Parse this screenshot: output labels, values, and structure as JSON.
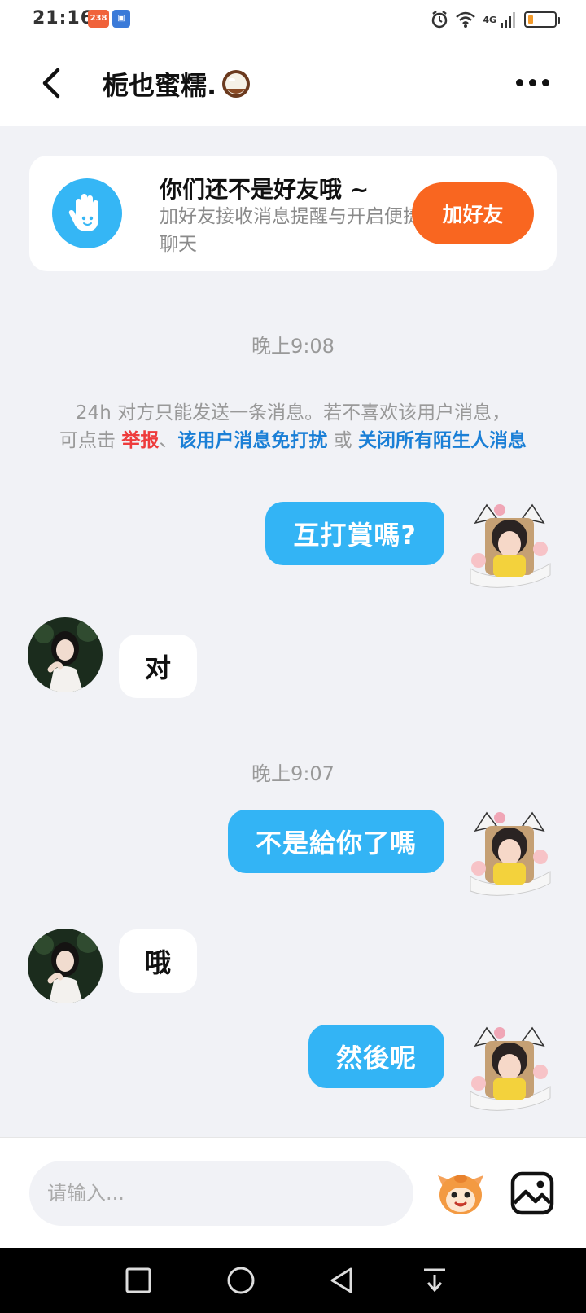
{
  "status_bar": {
    "time": "21:16",
    "badge_1": "238",
    "network": "4G",
    "battery_level": 0.2
  },
  "header": {
    "title": "栀也蜜糯.",
    "back_icon": "chevron-left-icon",
    "more_icon": "more-horizontal-icon"
  },
  "friend_card": {
    "title": "你们还不是好友哦 ~",
    "subtitle": "加好友接收消息提醒与开启便捷聊天",
    "button_label": "加好友",
    "icon": "hand-wave-icon",
    "accent_color": "#f96620",
    "icon_bg_color": "#35b6f5"
  },
  "chat": {
    "timestamp_1": "晚上9:08",
    "notice": {
      "line_1": "24h 对方只能发送一条消息。若不喜欢该用户消息，",
      "prefix": "可点击 ",
      "report": "举报",
      "sep": "、",
      "mute": "该用户消息免打扰",
      "or": " 或 ",
      "close_all": "关闭所有陌生人消息"
    },
    "messages": [
      {
        "side": "out",
        "text": "互打賞嗎?"
      },
      {
        "side": "in",
        "text": "对"
      },
      {
        "side": "out",
        "text": "不是給你了嗎"
      },
      {
        "side": "in",
        "text": "哦"
      },
      {
        "side": "out",
        "text": "然後呢"
      }
    ],
    "timestamp_2": "晚上9:07",
    "bubble_out_color": "#33b4f5"
  },
  "input_bar": {
    "placeholder": "请输入...",
    "emoji_icon": "sticker-icon",
    "image_icon": "image-icon"
  },
  "nav_bar": {
    "buttons": [
      "recents-square-icon",
      "home-circle-icon",
      "back-triangle-icon",
      "notification-pull-icon"
    ]
  }
}
